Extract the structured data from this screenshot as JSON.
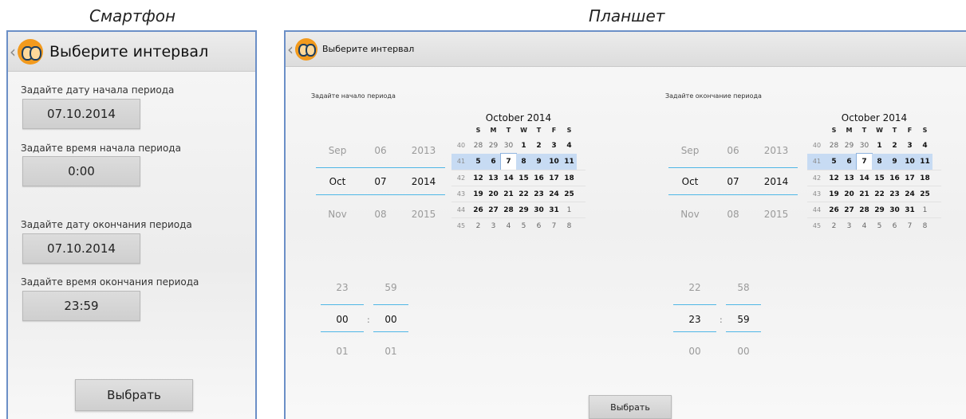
{
  "captions": {
    "phone": "Смартфон",
    "tablet": "Планшет"
  },
  "phone": {
    "title": "Выберите интервал",
    "start_date_label": "Задайте дату начала периода",
    "start_date_value": "07.10.2014",
    "start_time_label": "Задайте время начала периода",
    "start_time_value": "0:00",
    "end_date_label": "Задайте дату окончания периода",
    "end_date_value": "07.10.2014",
    "end_time_label": "Задайте время окончания периода",
    "end_time_value": "23:59",
    "select_button": "Выбрать"
  },
  "tablet": {
    "title": "Выберите интервал",
    "start_label": "Задайте начало периода",
    "end_label": "Задайте окончание периода",
    "select_button": "Выбрать",
    "start": {
      "date_picker": {
        "month": [
          "Sep",
          "Oct",
          "Nov"
        ],
        "day": [
          "06",
          "07",
          "08"
        ],
        "year": [
          "2013",
          "2014",
          "2015"
        ]
      },
      "time_picker": {
        "hour": [
          "23",
          "00",
          "01"
        ],
        "minute": [
          "59",
          "00",
          "01"
        ]
      }
    },
    "end": {
      "date_picker": {
        "month": [
          "Sep",
          "Oct",
          "Nov"
        ],
        "day": [
          "06",
          "07",
          "08"
        ],
        "year": [
          "2013",
          "2014",
          "2015"
        ]
      },
      "time_picker": {
        "hour": [
          "22",
          "23",
          "00"
        ],
        "minute": [
          "58",
          "59",
          "00"
        ]
      }
    },
    "time_separator": ":",
    "calendar": {
      "title": "October 2014",
      "weekdays": [
        "S",
        "M",
        "T",
        "W",
        "T",
        "F",
        "S"
      ],
      "weeks": [
        {
          "num": "40",
          "days": [
            "28",
            "29",
            "30",
            "1",
            "2",
            "3",
            "4"
          ]
        },
        {
          "num": "41",
          "days": [
            "5",
            "6",
            "7",
            "8",
            "9",
            "10",
            "11"
          ]
        },
        {
          "num": "42",
          "days": [
            "12",
            "13",
            "14",
            "15",
            "16",
            "17",
            "18"
          ]
        },
        {
          "num": "43",
          "days": [
            "19",
            "20",
            "21",
            "22",
            "23",
            "24",
            "25"
          ]
        },
        {
          "num": "44",
          "days": [
            "26",
            "27",
            "28",
            "29",
            "30",
            "31",
            "1"
          ]
        },
        {
          "num": "45",
          "days": [
            "2",
            "3",
            "4",
            "5",
            "6",
            "7",
            "8"
          ]
        }
      ]
    }
  }
}
